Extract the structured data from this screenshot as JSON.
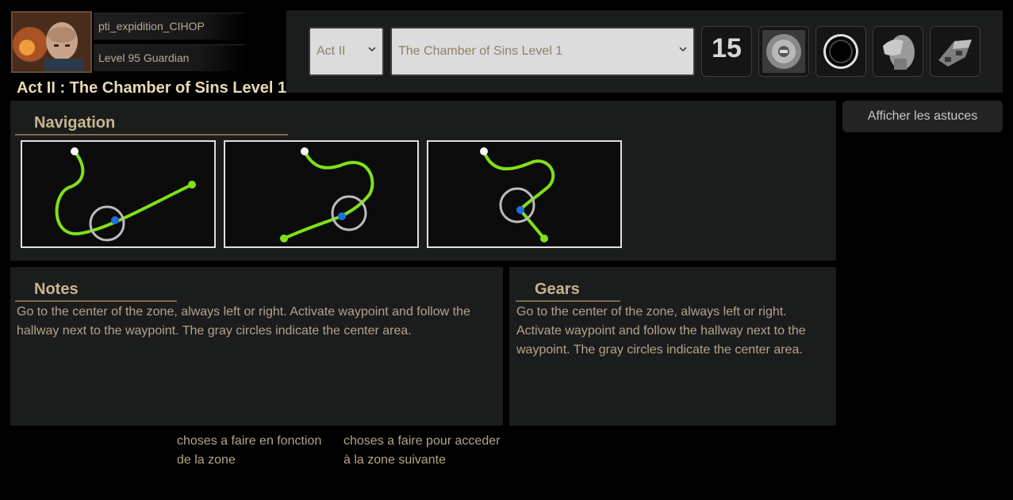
{
  "player": {
    "name": "pti_expidition_CIHOP",
    "level_label": "Level 95 Guardian"
  },
  "page": {
    "title": "Act II : The Chamber of Sins Level 1"
  },
  "toolbar": {
    "act_select": "Act II",
    "zone_select": "The Chamber of Sins Level 1",
    "zone_level": "15",
    "items": [
      "waypoint-item-icon",
      "portal-ring-icon",
      "stone-idol-icon",
      "machine-device-icon"
    ]
  },
  "tips_button": "Afficher les astuces",
  "navigation": {
    "title": "Navigation",
    "maps": [
      "layout-1",
      "layout-2",
      "layout-3"
    ],
    "colors": {
      "path": "#7fe01a",
      "center": "#bbbbbb",
      "waypoint": "#1d6fe0",
      "start": "#ffffff"
    }
  },
  "notes": {
    "title": "Notes",
    "text": "Go to the center of the zone, always left or right. Activate waypoint and follow the hallway next to the waypoint. The gray circles indicate the center area."
  },
  "gears": {
    "title": "Gears",
    "text": "Go to the center of the zone, always left or right. Activate waypoint and follow the hallway next to the waypoint. The gray circles indicate the center area."
  },
  "footer": {
    "zone_tasks": "choses a faire en fonction de la zone",
    "next_zone_tasks": "choses a faire pour acceder à la zone suivante"
  }
}
